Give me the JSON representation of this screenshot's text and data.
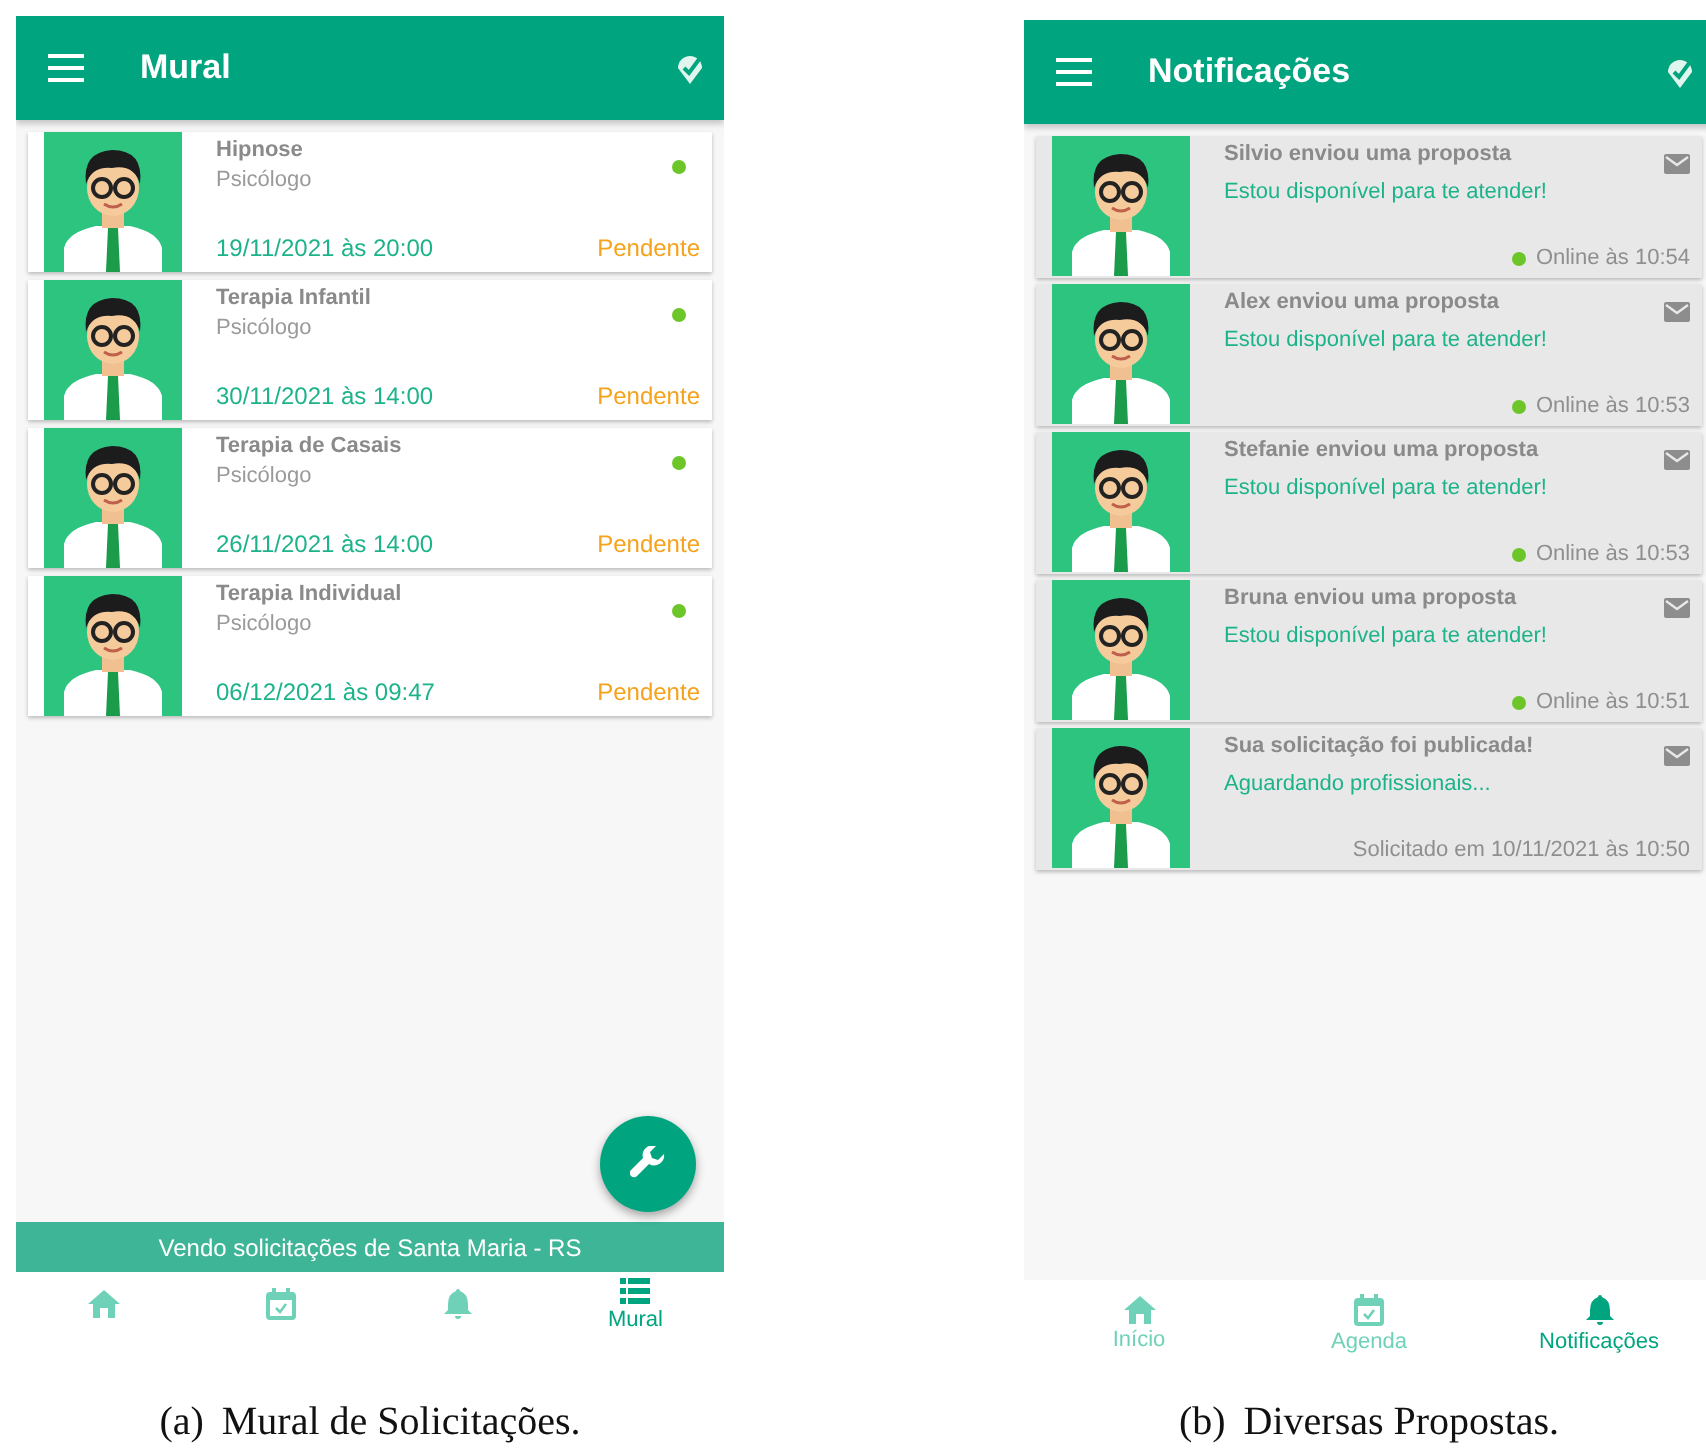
{
  "panels": [
    {
      "kind": "mural",
      "header": {
        "title": "Mural"
      },
      "cards": [
        {
          "title": "Hipnose",
          "subtitle": "Psicólogo",
          "date": "19/11/2021 às 20:00",
          "status": "Pendente",
          "online": true
        },
        {
          "title": "Terapia Infantil",
          "subtitle": "Psicólogo",
          "date": "30/11/2021 às 14:00",
          "status": "Pendente",
          "online": true
        },
        {
          "title": "Terapia de Casais",
          "subtitle": "Psicólogo",
          "date": "26/11/2021 às 14:00",
          "status": "Pendente",
          "online": true
        },
        {
          "title": "Terapia Individual",
          "subtitle": "Psicólogo",
          "date": "06/12/2021 às 09:47",
          "status": "Pendente",
          "online": true
        }
      ],
      "banner": "Vendo solicitações de Santa Maria - RS",
      "nav": [
        {
          "kind": "home",
          "selected": false
        },
        {
          "kind": "calendar",
          "selected": false
        },
        {
          "kind": "bell",
          "selected": false
        },
        {
          "kind": "list",
          "label": "Mural",
          "selected": true
        }
      ],
      "caption": {
        "label": "(a)",
        "text": "Mural de Solicitações."
      }
    },
    {
      "kind": "notifications",
      "header": {
        "title": "Notificações"
      },
      "notifications": [
        {
          "title": "Silvio enviou uma proposta",
          "message": "Estou disponível para te atender!",
          "footer": "Online às 10:54",
          "online": true
        },
        {
          "title": "Alex enviou uma proposta",
          "message": "Estou disponível para te atender!",
          "footer": "Online às 10:53",
          "online": true
        },
        {
          "title": "Stefanie enviou uma proposta",
          "message": "Estou disponível para te atender!",
          "footer": "Online às 10:53",
          "online": true
        },
        {
          "title": "Bruna enviou uma proposta",
          "message": "Estou disponível para te atender!",
          "footer": "Online às 10:51",
          "online": true
        },
        {
          "title": "Sua solicitação foi publicada!",
          "message": "Aguardando profissionais...",
          "footer": "Solicitado em 10/11/2021 às 10:50",
          "online": false
        }
      ],
      "nav": [
        {
          "kind": "home",
          "label": "Início",
          "selected": false
        },
        {
          "kind": "calendar",
          "label": "Agenda",
          "selected": false
        },
        {
          "kind": "bell",
          "label": "Notificações",
          "selected": true
        }
      ],
      "caption": {
        "label": "(b)",
        "text": "Diversas Propostas."
      }
    }
  ]
}
